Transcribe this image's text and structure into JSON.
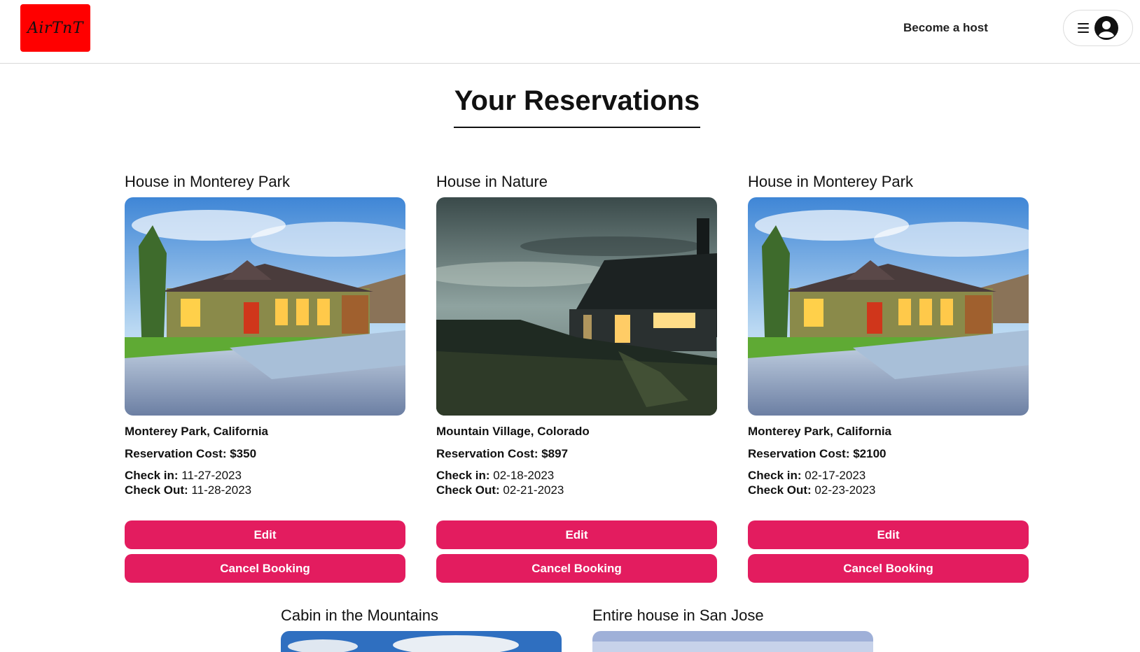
{
  "header": {
    "logo_text": "AirTnT",
    "become_host": "Become a host",
    "menu_icon": "hamburger-icon",
    "avatar_icon": "user-circle-icon"
  },
  "page": {
    "title": "Your Reservations"
  },
  "colors": {
    "brand_red": "#ff0000",
    "button_pink": "#e31c5f"
  },
  "reservations": [
    {
      "title": "House in Monterey Park",
      "location": "Monterey Park, California",
      "cost_label": "Reservation Cost:",
      "cost": "$350",
      "checkin_label": "Check in:",
      "checkin": "11-27-2023",
      "checkout_label": "Check Out:",
      "checkout": "11-28-2023",
      "edit_label": "Edit",
      "cancel_label": "Cancel Booking"
    },
    {
      "title": "House in Nature",
      "location": "Mountain Village, Colorado",
      "cost_label": "Reservation Cost:",
      "cost": "$897",
      "checkin_label": "Check in:",
      "checkin": "02-18-2023",
      "checkout_label": "Check Out:",
      "checkout": "02-21-2023",
      "edit_label": "Edit",
      "cancel_label": "Cancel Booking"
    },
    {
      "title": "House in Monterey Park",
      "location": "Monterey Park, California",
      "cost_label": "Reservation Cost:",
      "cost": "$2100",
      "checkin_label": "Check in:",
      "checkin": "02-17-2023",
      "checkout_label": "Check Out:",
      "checkout": "02-23-2023",
      "edit_label": "Edit",
      "cancel_label": "Cancel Booking"
    },
    {
      "title": "Cabin in the Mountains"
    },
    {
      "title": "Entire house in San Jose"
    }
  ]
}
